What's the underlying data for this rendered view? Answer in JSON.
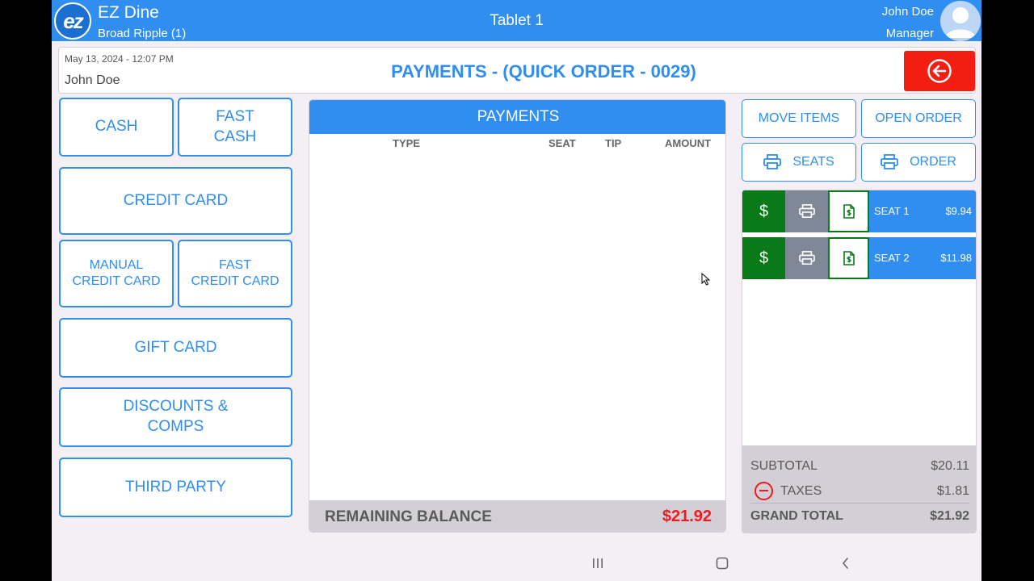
{
  "topbar": {
    "logo_text": "ez",
    "app_name": "EZ Dine",
    "location": "Broad Ripple (1)",
    "device_name": "Tablet 1",
    "user_name": "John Doe",
    "user_role": "Manager"
  },
  "header": {
    "datetime": "May 13, 2024 - 12:07 PM",
    "user": "John Doe",
    "title": "PAYMENTS - (QUICK ORDER - 0029)"
  },
  "payment_methods": {
    "cash": "CASH",
    "fast_cash": "FAST\nCASH",
    "credit_card": "CREDIT CARD",
    "manual_credit_card": "MANUAL\nCREDIT CARD",
    "fast_credit_card": "FAST\nCREDIT CARD",
    "gift_card": "GIFT CARD",
    "discounts": "DISCOUNTS &\nCOMPS",
    "third_party": "THIRD PARTY"
  },
  "payments_panel": {
    "title": "PAYMENTS",
    "columns": [
      "TYPE",
      "SEAT",
      "TIP",
      "AMOUNT"
    ],
    "rows": [],
    "remaining_label": "REMAINING BALANCE",
    "remaining_value": "$21.92"
  },
  "actions": {
    "move_items": "MOVE ITEMS",
    "open_order": "OPEN ORDER",
    "print_seats": "SEATS",
    "print_order": "ORDER"
  },
  "seats": [
    {
      "pay_symbol": "$",
      "label": "SEAT 1",
      "amount": "$9.94"
    },
    {
      "pay_symbol": "$",
      "label": "SEAT 2",
      "amount": "$11.98"
    }
  ],
  "totals": {
    "subtotal_label": "SUBTOTAL",
    "subtotal_value": "$20.11",
    "taxes_label": "TAXES",
    "taxes_value": "$1.81",
    "grand_total_label": "GRAND TOTAL",
    "grand_total_value": "$21.92"
  },
  "colors": {
    "accent": "#2f8ef0",
    "danger": "#f41d11",
    "pay_green": "#0a7a18",
    "print_gray": "#7f8896",
    "panel_gray": "#d3cfd6"
  },
  "icons": {
    "back": "arrow-left-circle-icon",
    "print": "printer-icon",
    "receipt": "receipt-dollar-icon",
    "nav_recents": "recents-icon",
    "nav_home": "home-icon",
    "nav_back": "nav-back-icon"
  }
}
